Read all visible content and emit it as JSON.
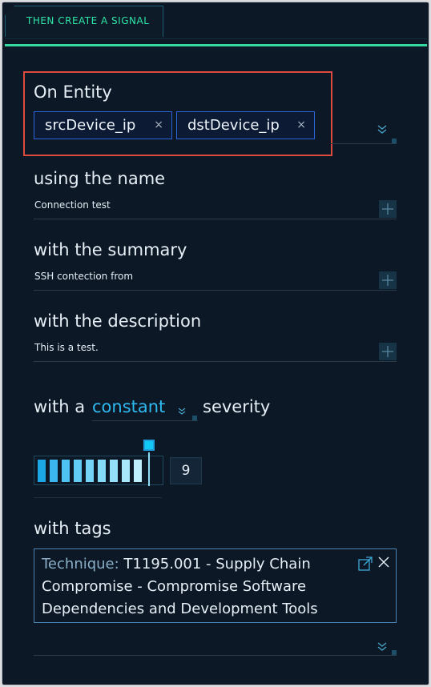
{
  "header": {
    "title": "THEN CREATE A SIGNAL"
  },
  "entity": {
    "label": "On Entity",
    "chips": [
      {
        "text": "srcDevice_ip",
        "remove": "×"
      },
      {
        "text": "dstDevice_ip",
        "remove": "×"
      }
    ]
  },
  "name_field": {
    "label": "using the name",
    "value": "Connection test"
  },
  "summary_field": {
    "label": "with the summary",
    "value": "SSH contection from"
  },
  "description_field": {
    "label": "with the description",
    "value": "This is a test."
  },
  "severity": {
    "prefix": "with a",
    "mode": "constant",
    "suffix": "severity",
    "value": "9",
    "level": 9,
    "max": 10
  },
  "tags": {
    "label": "with tags",
    "items": [
      {
        "key": "Technique:",
        "value": " T1195.001 - Supply Chain Compromise - Compromise Software Dependencies and Development Tools"
      }
    ]
  },
  "icons": {
    "chevron": "chevron-double-down-icon",
    "plus": "plus-icon",
    "link": "external-link-icon",
    "close": "close-icon"
  },
  "colors": {
    "background": "#0c1826",
    "accent": "#35d8a1",
    "link": "#2fb9f1",
    "chip_border": "#2a66d9",
    "highlight": "#dd4b3e"
  }
}
